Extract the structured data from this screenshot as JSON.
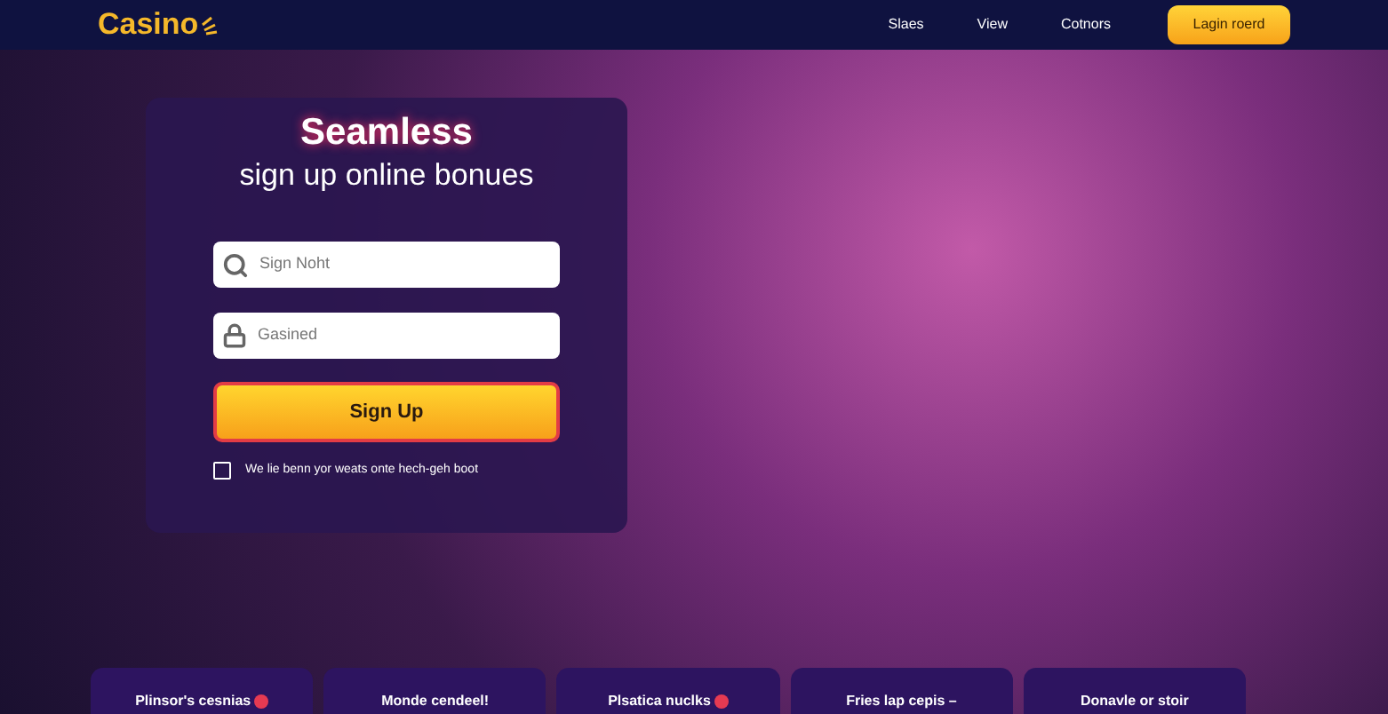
{
  "nav": {
    "logo": "Casino",
    "links": [
      "Slaes",
      "View",
      "Cotnors"
    ],
    "cta": "Lagin roerd"
  },
  "signup": {
    "title": "Seamless",
    "subtitle": "sign up online bonues",
    "fields": [
      {
        "kind": "search",
        "placeholder": "Sign Noht"
      },
      {
        "kind": "lock",
        "placeholder": "Gasined"
      }
    ],
    "button": "Sign Up",
    "consent": {
      "label": "We lie benn yor weats onte hech-geh boot",
      "checked": false
    }
  },
  "cards": [
    {
      "label": "Plinsor's cesnias",
      "badge": true
    },
    {
      "label": "Monde cendeel!",
      "badge": false
    },
    {
      "label": "Plsatica nuclks",
      "badge": true
    },
    {
      "label": "Fries lap cepis –",
      "badge": false
    },
    {
      "label": "Donavle or stoir",
      "badge": false
    }
  ]
}
